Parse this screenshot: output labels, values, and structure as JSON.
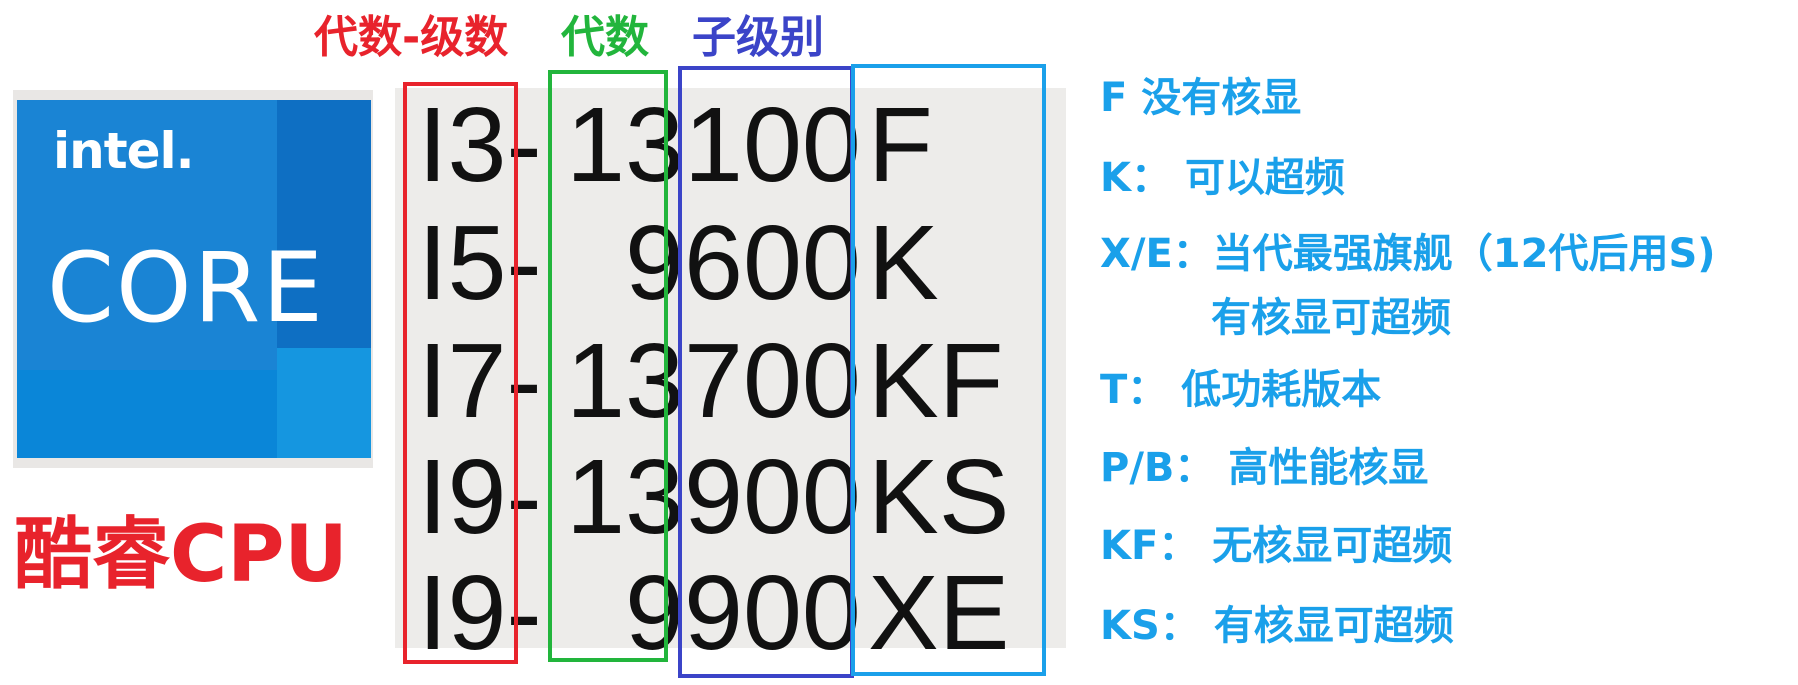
{
  "headers": {
    "gen_level": "代数-级数",
    "generation": "代数",
    "sub_level": "子级别"
  },
  "logo": {
    "brand": "intel.",
    "product": "CORE"
  },
  "title": "酷睿CPU",
  "models": [
    {
      "level": "I3-",
      "gen": "13",
      "sub": "100",
      "suffix": "F"
    },
    {
      "level": "I5-",
      "gen": "9",
      "sub": "600",
      "suffix": "K"
    },
    {
      "level": "I7-",
      "gen": "13",
      "sub": "700",
      "suffix": "KF"
    },
    {
      "level": "I9-",
      "gen": "13",
      "sub": "900",
      "suffix": "KS"
    },
    {
      "level": "I9-",
      "gen": "9",
      "sub": "900",
      "suffix": "XE"
    }
  ],
  "legend": [
    {
      "key": "F",
      "desc": "没有核显"
    },
    {
      "key": "K：",
      "desc": "可以超频"
    },
    {
      "key": "X/E：",
      "desc": "当代最强旗舰（12代后用S)",
      "desc2": "有核显可超频"
    },
    {
      "key": "T：",
      "desc": "低功耗版本"
    },
    {
      "key": "P/B：",
      "desc": "高性能核显"
    },
    {
      "key": "KF：",
      "desc": "无核显可超频"
    },
    {
      "key": "KS：",
      "desc": "有核显可超频"
    }
  ],
  "colors": {
    "red": "#e8232c",
    "green": "#22b53c",
    "blue": "#3b44c8",
    "cyan": "#1aa0ea"
  }
}
